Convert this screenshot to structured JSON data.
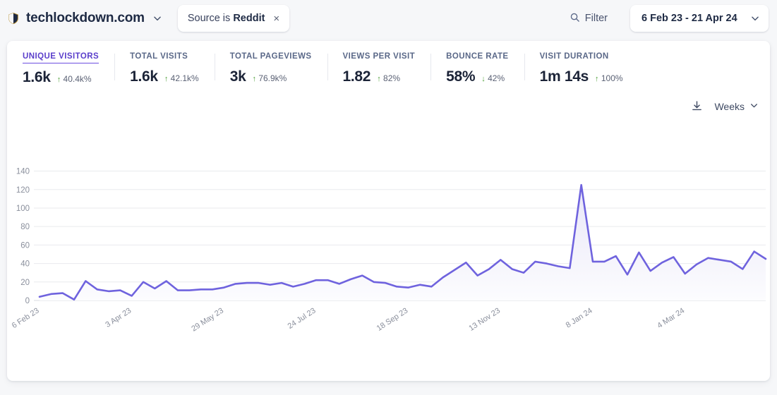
{
  "header": {
    "site_name": "techlockdown.com",
    "site_icon": "shield-icon",
    "site_chevron": "chevron-down-icon",
    "filter_pill": {
      "prefix": "Source is ",
      "value": "Reddit",
      "close": "×"
    },
    "filter_button": {
      "label": "Filter",
      "icon": "search-icon"
    },
    "date_range": {
      "label": "6 Feb 23 - 21 Apr 24",
      "chevron": "chevron-down-icon"
    }
  },
  "kpis": [
    {
      "label": "UNIQUE VISITORS",
      "value": "1.6k",
      "delta": "40.4k%",
      "direction": "up",
      "arrow": "↑",
      "active": true
    },
    {
      "label": "TOTAL VISITS",
      "value": "1.6k",
      "delta": "42.1k%",
      "direction": "up",
      "arrow": "↑",
      "active": false
    },
    {
      "label": "TOTAL PAGEVIEWS",
      "value": "3k",
      "delta": "76.9k%",
      "direction": "up",
      "arrow": "↑",
      "active": false
    },
    {
      "label": "VIEWS PER VISIT",
      "value": "1.82",
      "delta": "82%",
      "direction": "up",
      "arrow": "↑",
      "active": false
    },
    {
      "label": "BOUNCE RATE",
      "value": "58%",
      "delta": "42%",
      "direction": "down",
      "arrow": "↓",
      "active": false
    },
    {
      "label": "VISIT DURATION",
      "value": "1m 14s",
      "delta": "100%",
      "direction": "up",
      "arrow": "↑",
      "active": false
    }
  ],
  "chart_controls": {
    "download_icon": "download-icon",
    "interval_label": "Weeks",
    "interval_chevron": "chevron-down-icon"
  },
  "colors": {
    "line": "#6f63de",
    "area_top": "#eceaf9",
    "area_bottom": "#fbfbfe",
    "accent": "#5a3ecb",
    "grid": "#e9eaee",
    "tick_text": "#8a8f9c",
    "card_bg": "#ffffff",
    "page_bg": "#f6f7f9",
    "delta_up": "#4fa03a"
  },
  "chart_data": {
    "type": "line",
    "title": "",
    "xlabel": "",
    "ylabel": "",
    "ylim": [
      0,
      145
    ],
    "yticks": [
      0,
      20,
      40,
      60,
      80,
      100,
      120,
      140
    ],
    "grid": true,
    "legend": false,
    "metric": "Unique visitors",
    "interval": "Weeks",
    "xtick_labels": [
      "6 Feb 23",
      "3 Apr 23",
      "29 May 23",
      "24 Jul 23",
      "18 Sep 23",
      "13 Nov 23",
      "8 Jan 24",
      "4 Mar 24"
    ],
    "xtick_indices": [
      0,
      8,
      16,
      24,
      32,
      40,
      48,
      56
    ],
    "x": [
      "6 Feb 23",
      "13 Feb 23",
      "20 Feb 23",
      "27 Feb 23",
      "6 Mar 23",
      "13 Mar 23",
      "20 Mar 23",
      "27 Mar 23",
      "3 Apr 23",
      "10 Apr 23",
      "17 Apr 23",
      "24 Apr 23",
      "1 May 23",
      "8 May 23",
      "15 May 23",
      "22 May 23",
      "29 May 23",
      "5 Jun 23",
      "12 Jun 23",
      "19 Jun 23",
      "26 Jun 23",
      "3 Jul 23",
      "10 Jul 23",
      "17 Jul 23",
      "24 Jul 23",
      "31 Jul 23",
      "7 Aug 23",
      "14 Aug 23",
      "21 Aug 23",
      "28 Aug 23",
      "4 Sep 23",
      "11 Sep 23",
      "18 Sep 23",
      "25 Sep 23",
      "2 Oct 23",
      "9 Oct 23",
      "16 Oct 23",
      "23 Oct 23",
      "30 Oct 23",
      "6 Nov 23",
      "13 Nov 23",
      "20 Nov 23",
      "27 Nov 23",
      "4 Dec 23",
      "11 Dec 23",
      "18 Dec 23",
      "25 Dec 23",
      "1 Jan 24",
      "8 Jan 24",
      "15 Jan 24",
      "22 Jan 24",
      "29 Jan 24",
      "5 Feb 24",
      "12 Feb 24",
      "19 Feb 24",
      "26 Feb 24",
      "4 Mar 24",
      "11 Mar 24",
      "18 Mar 24",
      "25 Mar 24",
      "1 Apr 24",
      "8 Apr 24",
      "15 Apr 24",
      "21 Apr 24"
    ],
    "values": [
      4,
      7,
      8,
      1,
      21,
      12,
      10,
      11,
      5,
      20,
      13,
      21,
      11,
      11,
      12,
      12,
      14,
      18,
      19,
      19,
      17,
      19,
      15,
      18,
      22,
      22,
      18,
      23,
      27,
      20,
      19,
      15,
      14,
      17,
      15,
      25,
      33,
      41,
      27,
      34,
      44,
      34,
      30,
      42,
      40,
      37,
      35,
      125,
      42,
      42,
      48,
      28,
      52,
      32,
      41,
      47,
      29,
      39,
      46,
      44,
      42,
      34,
      53,
      45
    ]
  }
}
